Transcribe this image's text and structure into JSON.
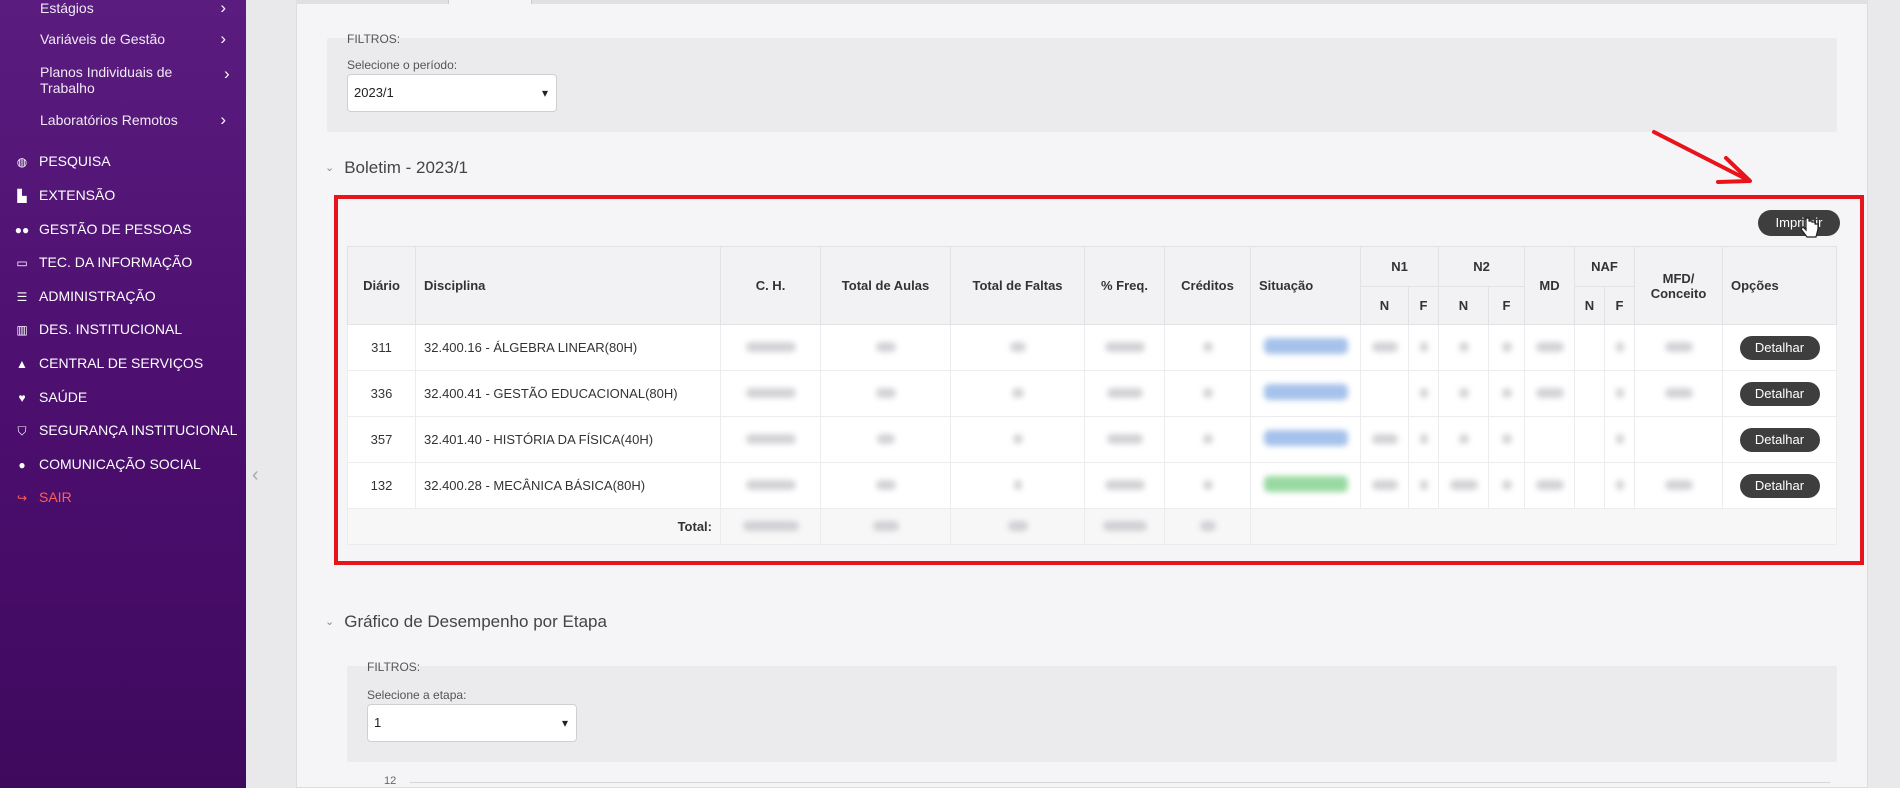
{
  "sidebar": {
    "sub_items": [
      {
        "label": "Estágios"
      },
      {
        "label": "Variáveis de Gestão"
      },
      {
        "label": "Planos Individuais de Trabalho"
      },
      {
        "label": "Laboratórios Remotos"
      }
    ],
    "main_items": [
      {
        "label": "PESQUISA",
        "icon": "globe-icon"
      },
      {
        "label": "EXTENSÃO",
        "icon": "building-icon"
      },
      {
        "label": "GESTÃO DE PESSOAS",
        "icon": "users-icon"
      },
      {
        "label": "TEC. DA INFORMAÇÃO",
        "icon": "laptop-icon"
      },
      {
        "label": "ADMINISTRAÇÃO",
        "icon": "list-icon"
      },
      {
        "label": "DES. INSTITUCIONAL",
        "icon": "chart-icon"
      },
      {
        "label": "CENTRAL DE SERVIÇOS",
        "icon": "bell-icon"
      },
      {
        "label": "SAÚDE",
        "icon": "heart-icon"
      },
      {
        "label": "SEGURANÇA INSTITUCIONAL",
        "icon": "shield-icon"
      },
      {
        "label": "COMUNICAÇÃO SOCIAL",
        "icon": "comment-icon"
      },
      {
        "label": "SAIR",
        "icon": "logout-icon"
      }
    ]
  },
  "period_filter": {
    "heading": "FILTROS:",
    "label": "Selecione o período:",
    "value": "2023/1"
  },
  "boletim": {
    "title": "Boletim - 2023/1",
    "print_label": "Imprimir",
    "headers": {
      "diario": "Diário",
      "disciplina": "Disciplina",
      "ch": "C. H.",
      "total_aulas": "Total de Aulas",
      "total_faltas": "Total de Faltas",
      "freq": "% Freq.",
      "creditos": "Créditos",
      "situacao": "Situação",
      "n1": "N1",
      "n2": "N2",
      "md": "MD",
      "naf": "NAF",
      "mfd": "MFD/ Conceito",
      "opcoes": "Opções",
      "n": "N",
      "f": "F"
    },
    "rows": [
      {
        "diario": "311",
        "disciplina": "32.400.16 - ÁLGEBRA LINEAR(80H)",
        "action": "Detalhar"
      },
      {
        "diario": "336",
        "disciplina": "32.400.41 - GESTÃO EDUCACIONAL(80H)",
        "action": "Detalhar"
      },
      {
        "diario": "357",
        "disciplina": "32.401.40 - HISTÓRIA DA FÍSICA(40H)",
        "action": "Detalhar"
      },
      {
        "diario": "132",
        "disciplina": "32.400.28 - MECÂNICA BÁSICA(80H)",
        "action": "Detalhar"
      }
    ],
    "total_label": "Total:"
  },
  "desempenho": {
    "title": "Gráfico de Desempenho por Etapa",
    "filter_heading": "FILTROS:",
    "filter_label": "Selecione a etapa:",
    "filter_value": "1",
    "y_tick": "12"
  },
  "colors": {
    "sidebar": "#4a0d6c",
    "highlight": "#e8141b",
    "button": "#3e3e3e"
  }
}
